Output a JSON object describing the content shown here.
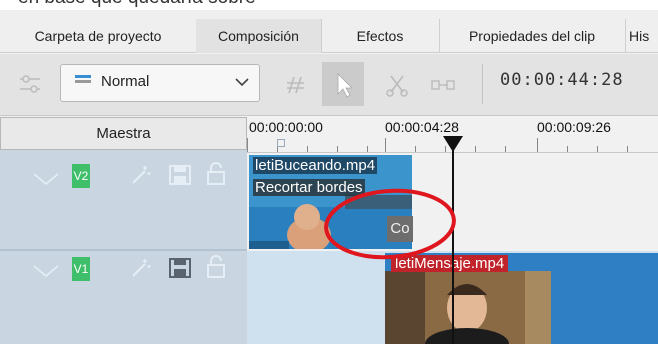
{
  "top_caption": "en base que quedaría sobre",
  "tabs": [
    {
      "label": "Carpeta de proyecto"
    },
    {
      "label": "Composición"
    },
    {
      "label": "Efectos"
    },
    {
      "label": "Propiedades del clip"
    },
    {
      "label": "His"
    }
  ],
  "toolbar": {
    "mode_select": "Normal",
    "timecode": "00:00:44:28"
  },
  "master": {
    "label": "Maestra"
  },
  "ruler": {
    "labels": [
      "00:00:00:00",
      "00:00:04:28",
      "00:00:09:26"
    ]
  },
  "tracks": [
    {
      "name": "V2",
      "badge_color": "#3fbf6a"
    },
    {
      "name": "V1",
      "badge_color": "#3fbf6a"
    }
  ],
  "clips": [
    {
      "title": "letiBuceando.mp4",
      "effect": "Recortar bordes",
      "composition": "Co"
    },
    {
      "title": "letiMensaje.mp4",
      "title_color": "#c0232a"
    }
  ],
  "annotation": {
    "color": "#e0161e"
  }
}
